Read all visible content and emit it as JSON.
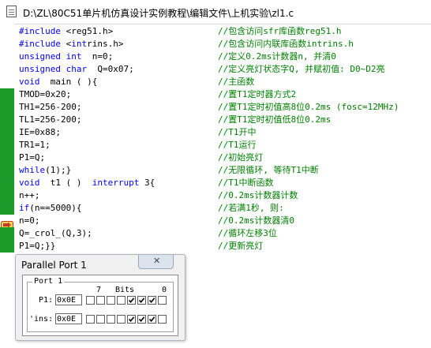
{
  "window": {
    "title": "D:\\ZL\\80C51单片机仿真设计实例教程\\编辑文件\\上机实验\\zl1.c"
  },
  "editor": {
    "lines": [
      {
        "code": "#include <reg51.h>",
        "kw": true,
        "comment": "//包含访问sfr库函数reg51.h"
      },
      {
        "code": "#include <intrins.h>",
        "kw": true,
        "comment": "//包含访问内联库函数intrins.h"
      },
      {
        "code": "unsigned int  n=0;",
        "kw": true,
        "comment": "//定义0.2ms计数器n, 并清0"
      },
      {
        "code": "unsigned char  Q=0x07;",
        "kw": true,
        "comment": "//定义亮灯状态字Q, 并赋初值: D0~D2亮"
      },
      {
        "code": "void  main ( ){",
        "kw": true,
        "comment": "//主函数"
      },
      {
        "code": "TMOD=0x20;",
        "kw": false,
        "comment": "//置T1定时器方式2"
      },
      {
        "code": "TH1=256-200;",
        "kw": false,
        "comment": "//置T1定时初值高8位0.2ms (fosc=12MHz)"
      },
      {
        "code": "TL1=256-200;",
        "kw": false,
        "comment": "//置T1定时初值低8位0.2ms"
      },
      {
        "code": "IE=0x88;",
        "kw": false,
        "comment": "//T1开中"
      },
      {
        "code": "TR1=1;",
        "kw": false,
        "comment": "//T1运行"
      },
      {
        "code": "P1=Q;",
        "kw": false,
        "comment": "//初始亮灯"
      },
      {
        "code": "while(1);}",
        "kw": true,
        "comment": "//无限循环, 等待T1中断"
      },
      {
        "code": "void  t1 ( )  interrupt 3{",
        "kw": true,
        "comment": "//T1中断函数"
      },
      {
        "code": "n++;",
        "kw": false,
        "comment": "//0.2ms计数器计数"
      },
      {
        "code": "if(n==5000){",
        "kw": true,
        "comment": "//若满1秒, 则:"
      },
      {
        "code": "n=0;",
        "kw": false,
        "comment": "//0.2ms计数器清0"
      },
      {
        "code": "Q=_crol_(Q,3);",
        "kw": false,
        "comment": "//循环左移3位"
      },
      {
        "code": "P1=Q;}}",
        "kw": false,
        "comment": "//更新亮灯"
      }
    ],
    "current_line_index": 15
  },
  "parallel_port": {
    "window_title": "Parallel Port 1",
    "group_label": "Port 1",
    "bits_header_high": "7",
    "bits_header_label": "Bits",
    "bits_header_low": "0",
    "register_label": "P1:",
    "register_value": "0x0E",
    "pins_label": "'ins:",
    "pins_value": "0x0E",
    "register_bits": [
      false,
      false,
      false,
      false,
      true,
      true,
      true,
      false
    ],
    "pins_bits": [
      false,
      false,
      false,
      false,
      true,
      true,
      true,
      false
    ]
  }
}
